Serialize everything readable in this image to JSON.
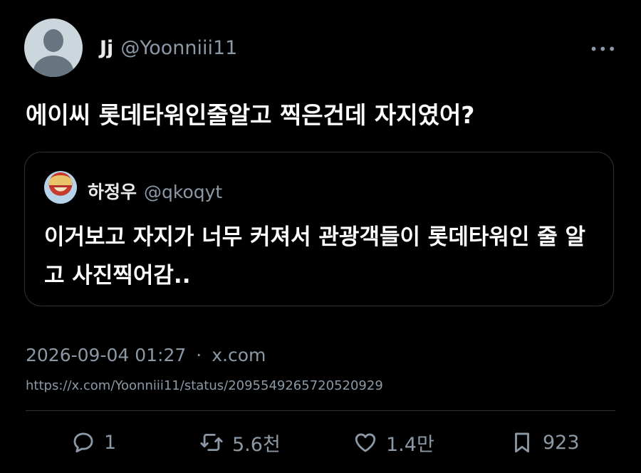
{
  "author": {
    "display_name": "Jj",
    "handle": "@Yoonniii11"
  },
  "tweet": {
    "text": "에이씨 롯데타워인줄알고 찍은건데 자지였어?"
  },
  "quoted": {
    "display_name": "하정우",
    "handle": "@qkoqyt",
    "text": "이거보고 자지가 너무 커져서 관광객들이 롯데타워인 줄 알고 사진찍어감.."
  },
  "meta": {
    "timestamp": "2026-09-04 01:27",
    "separator": "·",
    "source": "x.com",
    "url": "https://x.com/Yoonniii11/status/2095549265720520929"
  },
  "stats": {
    "replies": "1",
    "retweets": "5.6천",
    "likes": "1.4만",
    "bookmarks": "923"
  },
  "icons": [
    "more-icon",
    "reply-icon",
    "retweet-icon",
    "like-icon",
    "bookmark-icon"
  ],
  "colors": {
    "background": "#000000",
    "text": "#e7e9ea",
    "secondary": "#8b98a5",
    "border": "#2f3336"
  }
}
